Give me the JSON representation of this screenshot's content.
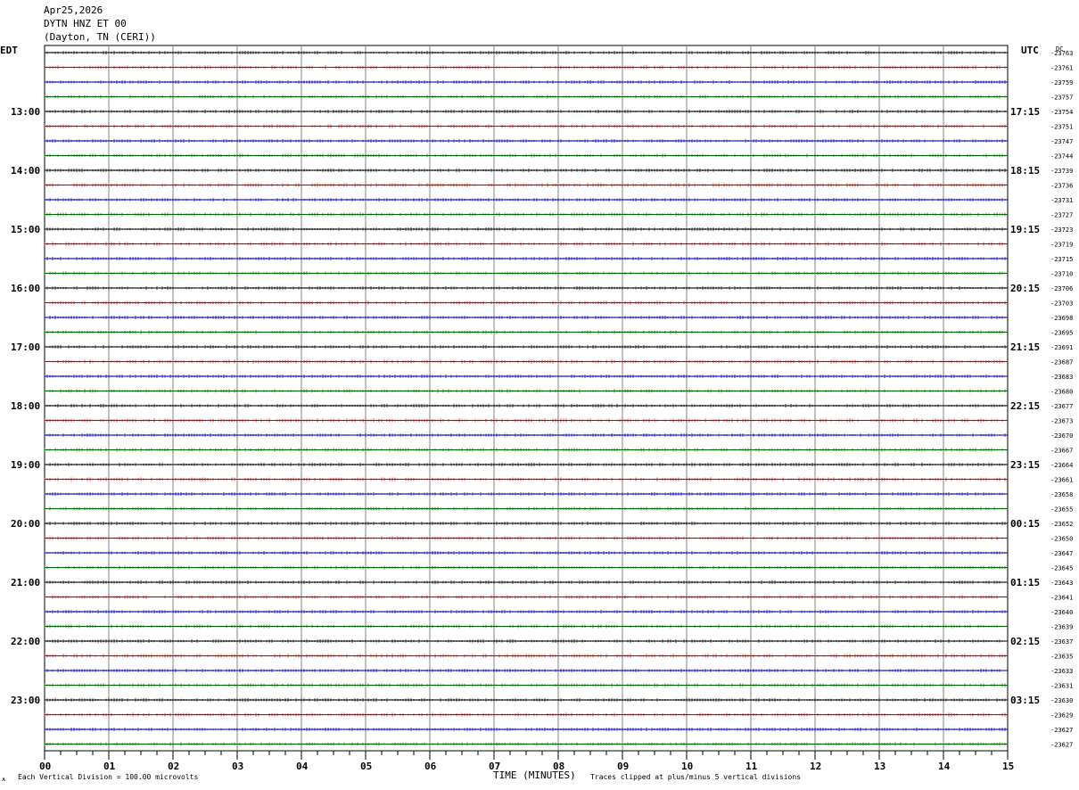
{
  "header": {
    "date": "Apr25,2026",
    "station": "DYTN HNZ ET 00",
    "location": "(Dayton, TN (CERI))"
  },
  "left_tz": "EDT",
  "right_tz": "UTC",
  "dc_label": "DC",
  "footer": {
    "scale_note": "Each Vertical Division =  100.00 microvolts",
    "xlabel": "TIME (MINUTES)",
    "clip_note": "Traces clipped at plus/minus 5 vertical divisions",
    "corner_mark": "ᴀ"
  },
  "colors": {
    "black": "#000000",
    "red": "#cc0000",
    "blue": "#0000cc",
    "green": "#006600",
    "grid": "#808080"
  },
  "chart_data": {
    "type": "line",
    "title": "DYTN HNZ ET 00",
    "xlabel": "TIME (MINUTES)",
    "ylabel": "",
    "xlim": [
      0,
      15
    ],
    "x_ticks": [
      "00",
      "01",
      "02",
      "03",
      "04",
      "05",
      "06",
      "07",
      "08",
      "09",
      "10",
      "11",
      "12",
      "13",
      "14",
      "15"
    ],
    "left_hour_labels": [
      "13:00",
      "14:00",
      "15:00",
      "16:00",
      "17:00",
      "18:00",
      "19:00",
      "20:00",
      "21:00",
      "22:00",
      "23:00"
    ],
    "right_hour_labels": [
      "17:15",
      "18:15",
      "19:15",
      "20:15",
      "21:15",
      "22:15",
      "23:15",
      "00:15",
      "01:15",
      "02:15",
      "03:15"
    ],
    "trace_colors": [
      "black",
      "red",
      "blue",
      "green"
    ],
    "dc_offsets": [
      "-23763",
      "-23761",
      "-23759",
      "-23757",
      "-23754",
      "-23751",
      "-23747",
      "-23744",
      "-23739",
      "-23736",
      "-23731",
      "-23727",
      "-23723",
      "-23719",
      "-23715",
      "-23710",
      "-23706",
      "-23703",
      "-23698",
      "-23695",
      "-23691",
      "-23687",
      "-23683",
      "-23680",
      "-23677",
      "-23673",
      "-23670",
      "-23667",
      "-23664",
      "-23661",
      "-23658",
      "-23655",
      "-23652",
      "-23650",
      "-23647",
      "-23645",
      "-23643",
      "-23641",
      "-23640",
      "-23639",
      "-23637",
      "-23635",
      "-23633",
      "-23631",
      "-23630",
      "-23629",
      "-23627",
      "-23627"
    ],
    "grid": true
  }
}
